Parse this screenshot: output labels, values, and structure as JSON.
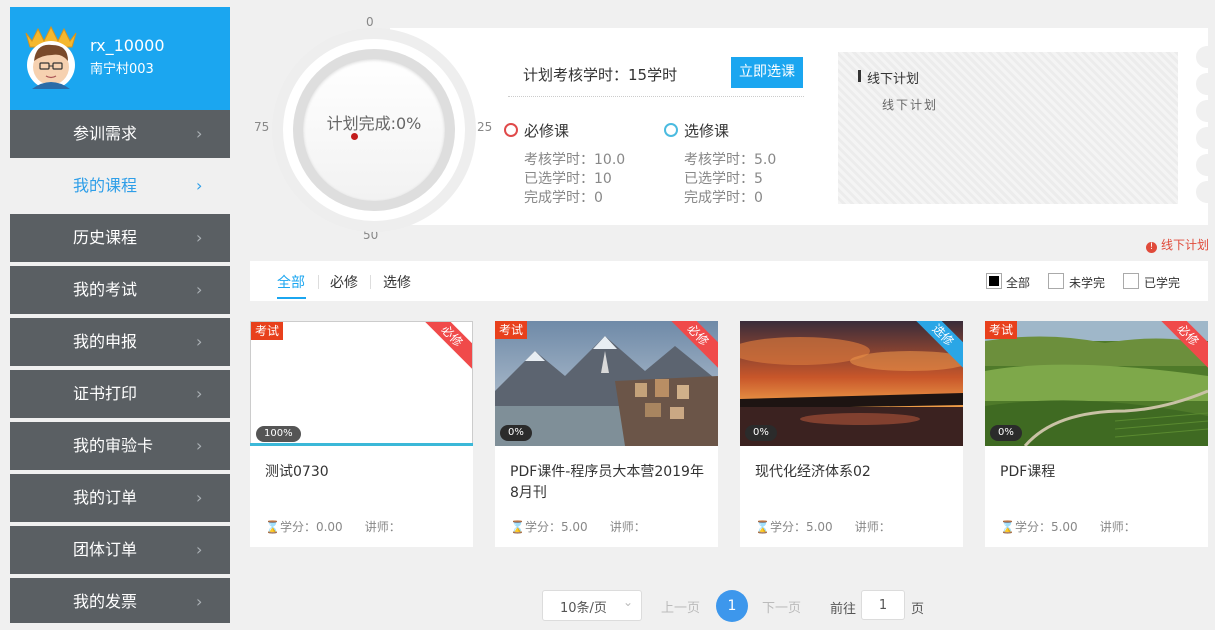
{
  "user": {
    "name": "rx_10000",
    "org": "南宁村003"
  },
  "sidebar": {
    "items": [
      {
        "label": "参训需求"
      },
      {
        "label": "我的课程"
      },
      {
        "label": "历史课程"
      },
      {
        "label": "我的考试"
      },
      {
        "label": "我的申报"
      },
      {
        "label": "证书打印"
      },
      {
        "label": "我的审验卡"
      },
      {
        "label": "我的订单"
      },
      {
        "label": "团体订单"
      },
      {
        "label": "我的发票"
      }
    ],
    "active_index": 1
  },
  "gauge": {
    "label": "计划完成:0%",
    "progress_percent": 0,
    "ticks": {
      "top": "0",
      "right": "25",
      "bottom": "50",
      "left": "75"
    }
  },
  "plan": {
    "hours_text": "计划考核学时：15学时",
    "choose_button": "立即选课",
    "required": {
      "title": "必修课",
      "assess": "考核学时：10.0",
      "selected": "已选学时：10",
      "completed": "完成学时：0"
    },
    "elective": {
      "title": "选修课",
      "assess": "考核学时：5.0",
      "selected": "已选学时：5",
      "completed": "完成学时：0"
    }
  },
  "offline": {
    "title": "线下计划",
    "subtitle": "线下计划",
    "link": "线下计划"
  },
  "filters": {
    "tabs": [
      "全部",
      "必修",
      "选修"
    ],
    "checks": [
      "全部",
      "未学完",
      "已学完"
    ]
  },
  "courses": [
    {
      "title": "测试0730",
      "credit": "学分：0.00",
      "teacher": "讲师：",
      "badge": "考试",
      "type": "必修",
      "progress": "100%"
    },
    {
      "title": "PDF课件-程序员大本营2019年8月刊",
      "credit": "学分：5.00",
      "teacher": "讲师：",
      "badge": "考试",
      "type": "必修",
      "progress": "0%"
    },
    {
      "title": "现代化经济体系02",
      "credit": "学分：5.00",
      "teacher": "讲师：",
      "badge": "",
      "type": "选修",
      "progress": "0%"
    },
    {
      "title": "PDF课程",
      "credit": "学分：5.00",
      "teacher": "讲师：",
      "badge": "考试",
      "type": "必修",
      "progress": "0%"
    }
  ],
  "pagination": {
    "page_size": "10条/页",
    "prev": "上一页",
    "current": "1",
    "next": "下一页",
    "goto_label": "前往",
    "goto_value": "1",
    "unit": "页"
  },
  "colors": {
    "sidebar_bg": "#5a5f63",
    "accent": "#1ba6f0",
    "required_red": "#f04a4a",
    "elective_blue": "#2aa6e6"
  }
}
